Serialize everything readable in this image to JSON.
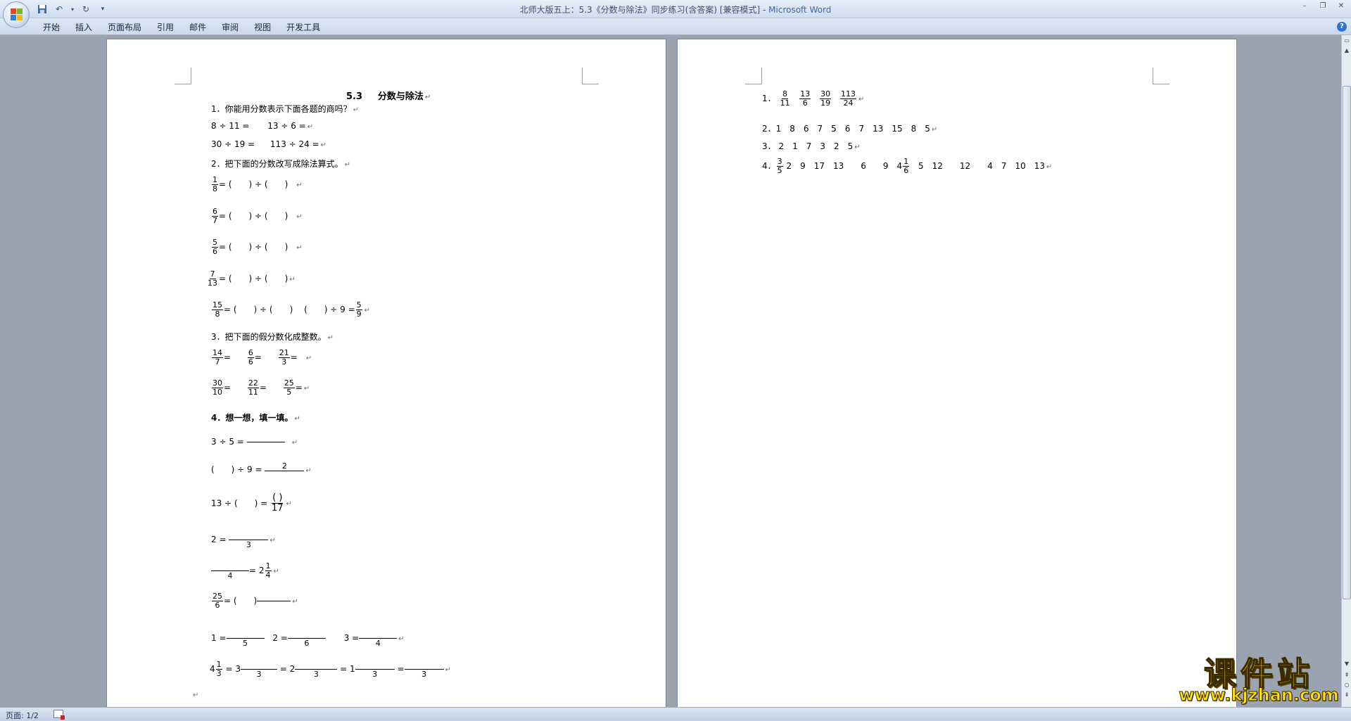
{
  "window": {
    "title": "北师大版五上：5.3《分数与除法》同步练习(含答案) [兼容模式] - ",
    "app_name": "Microsoft Word",
    "minimize": "–",
    "restore": "❐",
    "close": "✕"
  },
  "ribbon": {
    "tabs": [
      "开始",
      "插入",
      "页面布局",
      "引用",
      "邮件",
      "审阅",
      "视图",
      "开发工具"
    ],
    "help": "?"
  },
  "status": {
    "page_indicator": "页面: 1/2"
  },
  "pm": "↵",
  "page1": {
    "title_num": "5.3",
    "title_text": "分数与除法",
    "q1": "1．你能用分数表示下面各题的商吗？",
    "q1_a": "8 ÷ 11 =",
    "q1_b": "13 ÷ 6 =",
    "q1_c": "30 ÷ 19 =",
    "q1_d": "113 ÷ 24 =",
    "q2": "2．把下面的分数改写成除法算式。",
    "paren_div": "= (　　) ÷ (　　)",
    "q2_last_tail": "(　　) ÷ 9 =",
    "q2_fracs": [
      {
        "n": "1",
        "d": "8"
      },
      {
        "n": "6",
        "d": "7"
      },
      {
        "n": "5",
        "d": "6"
      },
      {
        "n": "7",
        "d": "13"
      },
      {
        "n": "15",
        "d": "8"
      }
    ],
    "q2_last_rhs": {
      "n": "5",
      "d": "9"
    },
    "q3": "3．把下面的假分数化成整数。",
    "q3_row1": [
      {
        "n": "14",
        "d": "7"
      },
      {
        "n": "6",
        "d": "6"
      },
      {
        "n": "21",
        "d": "3"
      }
    ],
    "q3_row2": [
      {
        "n": "30",
        "d": "10"
      },
      {
        "n": "22",
        "d": "11"
      },
      {
        "n": "25",
        "d": "5"
      }
    ],
    "eq": "=",
    "q4": "4．想一想，填一填。",
    "q4_1": "3 ÷ 5 =",
    "q4_2_left": "(　　) ÷ 9 =",
    "q4_2_top": "2",
    "q4_3_left": "13 ÷ (　　) =",
    "q4_3_top": "( )",
    "q4_3_bot": "17",
    "q4_4_left": "2 =",
    "q4_4_bot": "3",
    "q4_5_bot": "4",
    "q4_5_right": "= 2",
    "q4_5_frac": {
      "n": "1",
      "d": "4"
    },
    "q4_6_frac": {
      "n": "25",
      "d": "6"
    },
    "q4_6_mid": "= (　　)",
    "q4_7": [
      {
        "left": "1 =",
        "bot": "5"
      },
      {
        "left": "2 =",
        "bot": "6"
      },
      {
        "left": "3 =",
        "bot": "4"
      }
    ],
    "q4_8_whole": "4",
    "q4_8_frac": {
      "n": "1",
      "d": "3"
    },
    "q4_8_parts": [
      {
        "left": "= 3",
        "bot": "3"
      },
      {
        "left": "= 2",
        "bot": "3"
      },
      {
        "left": "= 1",
        "bot": "3"
      },
      {
        "left": "=",
        "bot": "3"
      }
    ]
  },
  "page2": {
    "a1_label": "1．",
    "a1_fracs": [
      {
        "n": "8",
        "d": "11"
      },
      {
        "n": "13",
        "d": "6"
      },
      {
        "n": "30",
        "d": "19"
      },
      {
        "n": "113",
        "d": "24"
      }
    ],
    "a2": "2．1　8　6　7　5　6　7　13　15　8　5",
    "a3": "3．  2　1　7　3　2　5",
    "a4_label": "4．",
    "a4_frac1": {
      "n": "3",
      "d": "5"
    },
    "a4_mid": "2　9　17　13　　6　　9　4",
    "a4_frac2": {
      "n": "1",
      "d": "6"
    },
    "a4_tail": "5　12　　12　　4　7　10　13"
  },
  "watermark": {
    "main": "课件站",
    "url": "www.kjzhan.com"
  },
  "colors": {
    "workspace": "#9aa3b0",
    "ribbon": "#cad8ec",
    "watermark": "#ffe000"
  }
}
